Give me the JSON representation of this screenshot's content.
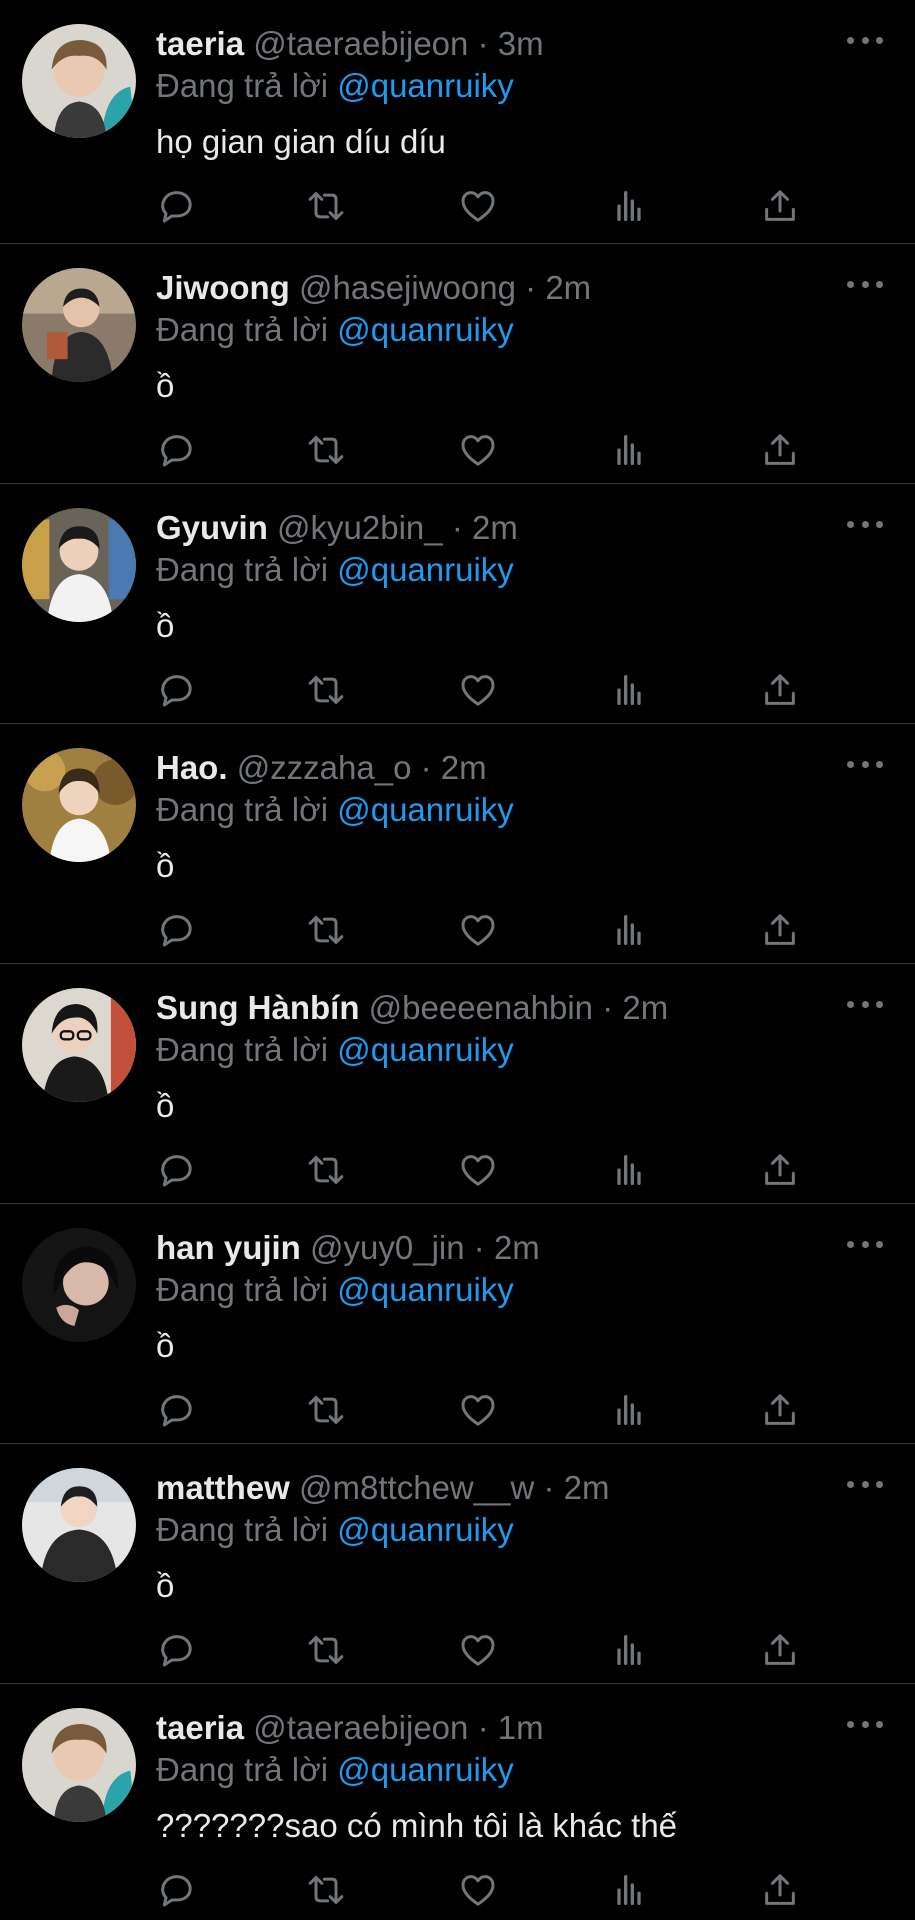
{
  "tweets": [
    {
      "name": "taeria",
      "handle": "@taeraebijeon",
      "separator": "·",
      "time": "3m",
      "reply_prefix": "Đang trả lời",
      "reply_to": "@quanruiky",
      "text": "họ gian gian díu díu",
      "avatar_color": "#3a4a48",
      "avatar_accent": "#2aa4a8"
    },
    {
      "name": "Jiwoong",
      "handle": "@hasejiwoong",
      "separator": "·",
      "time": "2m",
      "reply_prefix": "Đang trả lời",
      "reply_to": "@quanruiky",
      "text": "ồ",
      "avatar_color": "#6b5a4a",
      "avatar_accent": "#2b2b2b"
    },
    {
      "name": "Gyuvin",
      "handle": "@kyu2bin_",
      "separator": "·",
      "time": "2m",
      "reply_prefix": "Đang trả lời",
      "reply_to": "@quanruiky",
      "text": "ồ",
      "avatar_color": "#8a7a5a",
      "avatar_accent": "#e8e8e8"
    },
    {
      "name": "Hao.",
      "handle": "@zzzaha_o",
      "separator": "·",
      "time": "2m",
      "reply_prefix": "Đang trả lời",
      "reply_to": "@quanruiky",
      "text": "ồ",
      "avatar_color": "#9a7a3a",
      "avatar_accent": "#f2f2f2"
    },
    {
      "name": "Sung Hànbín",
      "handle": "@beeeenahbin",
      "separator": "·",
      "time": "2m",
      "reply_prefix": "Đang trả lời",
      "reply_to": "@quanruiky",
      "text": "ồ",
      "avatar_color": "#d8d4cc",
      "avatar_accent": "#1a1a1a"
    },
    {
      "name": "han yujin",
      "handle": "@yuy0_jin",
      "separator": "·",
      "time": "2m",
      "reply_prefix": "Đang trả lời",
      "reply_to": "@quanruiky",
      "text": "ồ",
      "avatar_color": "#1a1a1a",
      "avatar_accent": "#c9a89a"
    },
    {
      "name": "matthew",
      "handle": "@m8ttchew__w",
      "separator": "·",
      "time": "2m",
      "reply_prefix": "Đang trả lời",
      "reply_to": "@quanruiky",
      "text": "ồ",
      "avatar_color": "#e4e4e4",
      "avatar_accent": "#2a2a2a"
    },
    {
      "name": "taeria",
      "handle": "@taeraebijeon",
      "separator": "·",
      "time": "1m",
      "reply_prefix": "Đang trả lời",
      "reply_to": "@quanruiky",
      "text": "???????sao có mình tôi là khác thế",
      "avatar_color": "#3a4a48",
      "avatar_accent": "#2aa4a8"
    }
  ],
  "icons": {
    "reply": "reply-icon",
    "retweet": "retweet-icon",
    "like": "like-icon",
    "views": "views-icon",
    "share": "share-icon",
    "more": "more-icon"
  }
}
